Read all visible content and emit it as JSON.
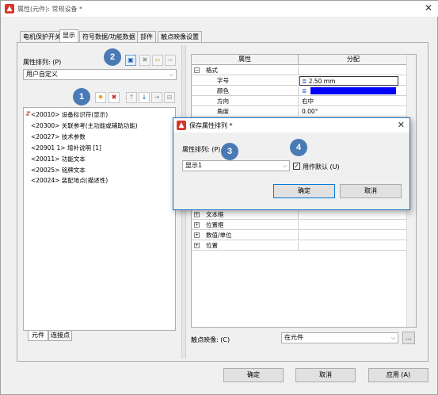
{
  "window": {
    "title": "属性(元件): 常规设备 *"
  },
  "tabs": [
    {
      "label": "电机保护开关"
    },
    {
      "label": "显示"
    },
    {
      "label": "符号数据/功能数据"
    },
    {
      "label": "部件"
    },
    {
      "label": "触点映像设置"
    }
  ],
  "left": {
    "sort_label": "属性排列: (P)",
    "sort_value": "用户自定义",
    "tree": [
      {
        "label": "<20010> 设备标识符(显示)"
      },
      {
        "label": "<20300> 关联参考(主功能或辅助功能)"
      },
      {
        "label": "<20027> 技术参数"
      },
      {
        "label": "<20901 1> 增补说明 [1]"
      },
      {
        "label": "<20011> 功能文本"
      },
      {
        "label": "<20025> 铭牌文本"
      },
      {
        "label": "<20024> 装配地点(描述性)"
      }
    ],
    "bottom_tabs": [
      {
        "label": "元件"
      },
      {
        "label": "连接点"
      }
    ]
  },
  "grid": {
    "header_property": "属性",
    "header_value": "分配",
    "rows": [
      {
        "name": "格式",
        "value": ""
      },
      {
        "name": "字号",
        "value": "2.50 mm"
      },
      {
        "name": "颜色",
        "value": ""
      },
      {
        "name": "方向",
        "value": "右中"
      },
      {
        "name": "角度",
        "value": "0.00°"
      }
    ],
    "lower_rows": [
      {
        "name": "文本框"
      },
      {
        "name": "位置框"
      },
      {
        "name": "数值/单位"
      },
      {
        "name": "位置"
      }
    ],
    "color_swatch": "#0000ff"
  },
  "contact_image": {
    "label": "触点映像: (C)",
    "value": "在元件",
    "more": "..."
  },
  "footer": {
    "ok": "确定",
    "cancel": "取消",
    "apply": "应用 (A)"
  },
  "dialog": {
    "title": "保存属性排列 *",
    "sort_label": "属性排列: (P)",
    "sort_value": "显示1",
    "default_label": "用作默认 (U)",
    "default_checked": "✓",
    "ok": "确定",
    "cancel": "取消"
  },
  "badges": [
    "1",
    "2",
    "3",
    "4"
  ],
  "colors": {
    "badge": "#4a7ab6",
    "accent": "#0078d7",
    "app_icon": "#d8352a"
  }
}
